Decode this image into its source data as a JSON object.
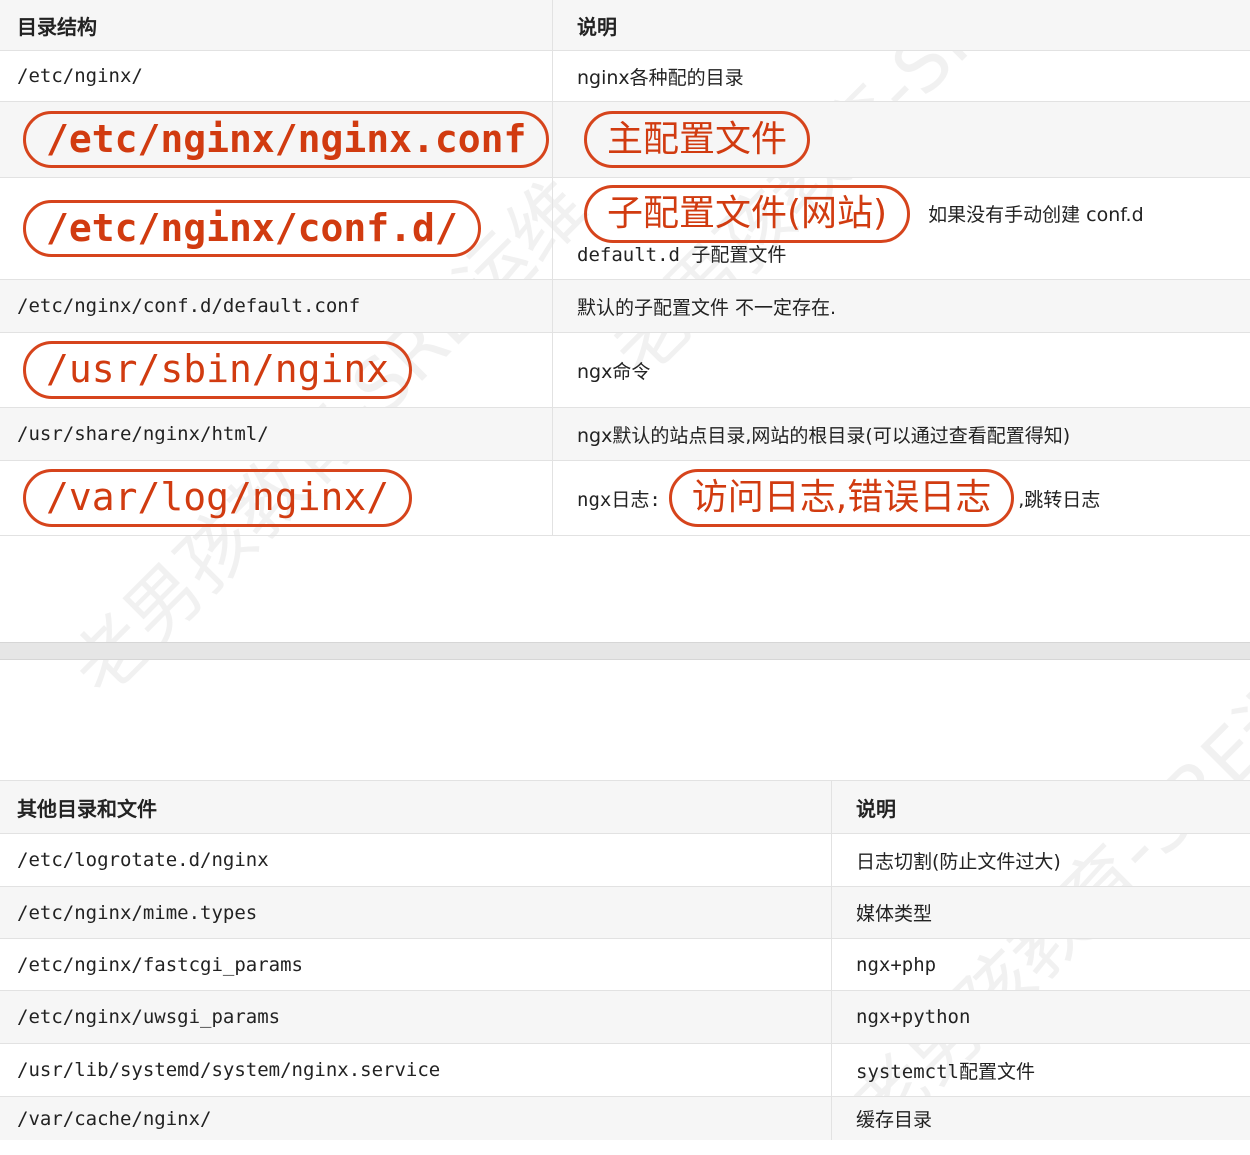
{
  "table1": {
    "headers": [
      "目录结构",
      "说明"
    ],
    "rows": [
      {
        "path": "/etc/nginx/",
        "desc": "nginx各种配的目录"
      },
      {
        "path": "/etc/nginx/nginx.conf",
        "desc": "主配置文件"
      },
      {
        "path": "/etc/nginx/conf.d/",
        "desc_pill": "子配置文件(网站)",
        "desc_after": "如果没有手动创建 conf.d",
        "desc_line2": "default.d 子配置文件"
      },
      {
        "path": "/etc/nginx/conf.d/default.conf",
        "desc": "默认的子配置文件 不一定存在."
      },
      {
        "path": "/usr/sbin/nginx",
        "desc": "ngx命令"
      },
      {
        "path": "/usr/share/nginx/html/",
        "desc": "ngx默认的站点目录,网站的根目录(可以通过查看配置得知)"
      },
      {
        "path": "/var/log/nginx/",
        "desc_prefix": "ngx日志:",
        "desc_pill": "访问日志,错误日志",
        "desc_suffix": ",跳转日志"
      }
    ]
  },
  "table2": {
    "headers": [
      "其他目录和文件",
      "说明"
    ],
    "rows": [
      {
        "path": "/etc/logrotate.d/nginx",
        "desc": "日志切割(防止文件过大)"
      },
      {
        "path": "/etc/nginx/mime.types",
        "desc": "媒体类型"
      },
      {
        "path": "/etc/nginx/fastcgi_params",
        "desc": "ngx+php"
      },
      {
        "path": "/etc/nginx/uwsgi_params",
        "desc": "ngx+python"
      },
      {
        "path": "/usr/lib/systemd/system/nginx.service",
        "desc": "systemctl配置文件"
      },
      {
        "path": "/var/cache/nginx/",
        "desc": "缓存目录"
      }
    ]
  },
  "watermark": "老男孩教育-SRE运维",
  "colors": {
    "annotation": "#d6441c",
    "header_bg": "#f6f6f6",
    "border": "#e2e2e2"
  }
}
